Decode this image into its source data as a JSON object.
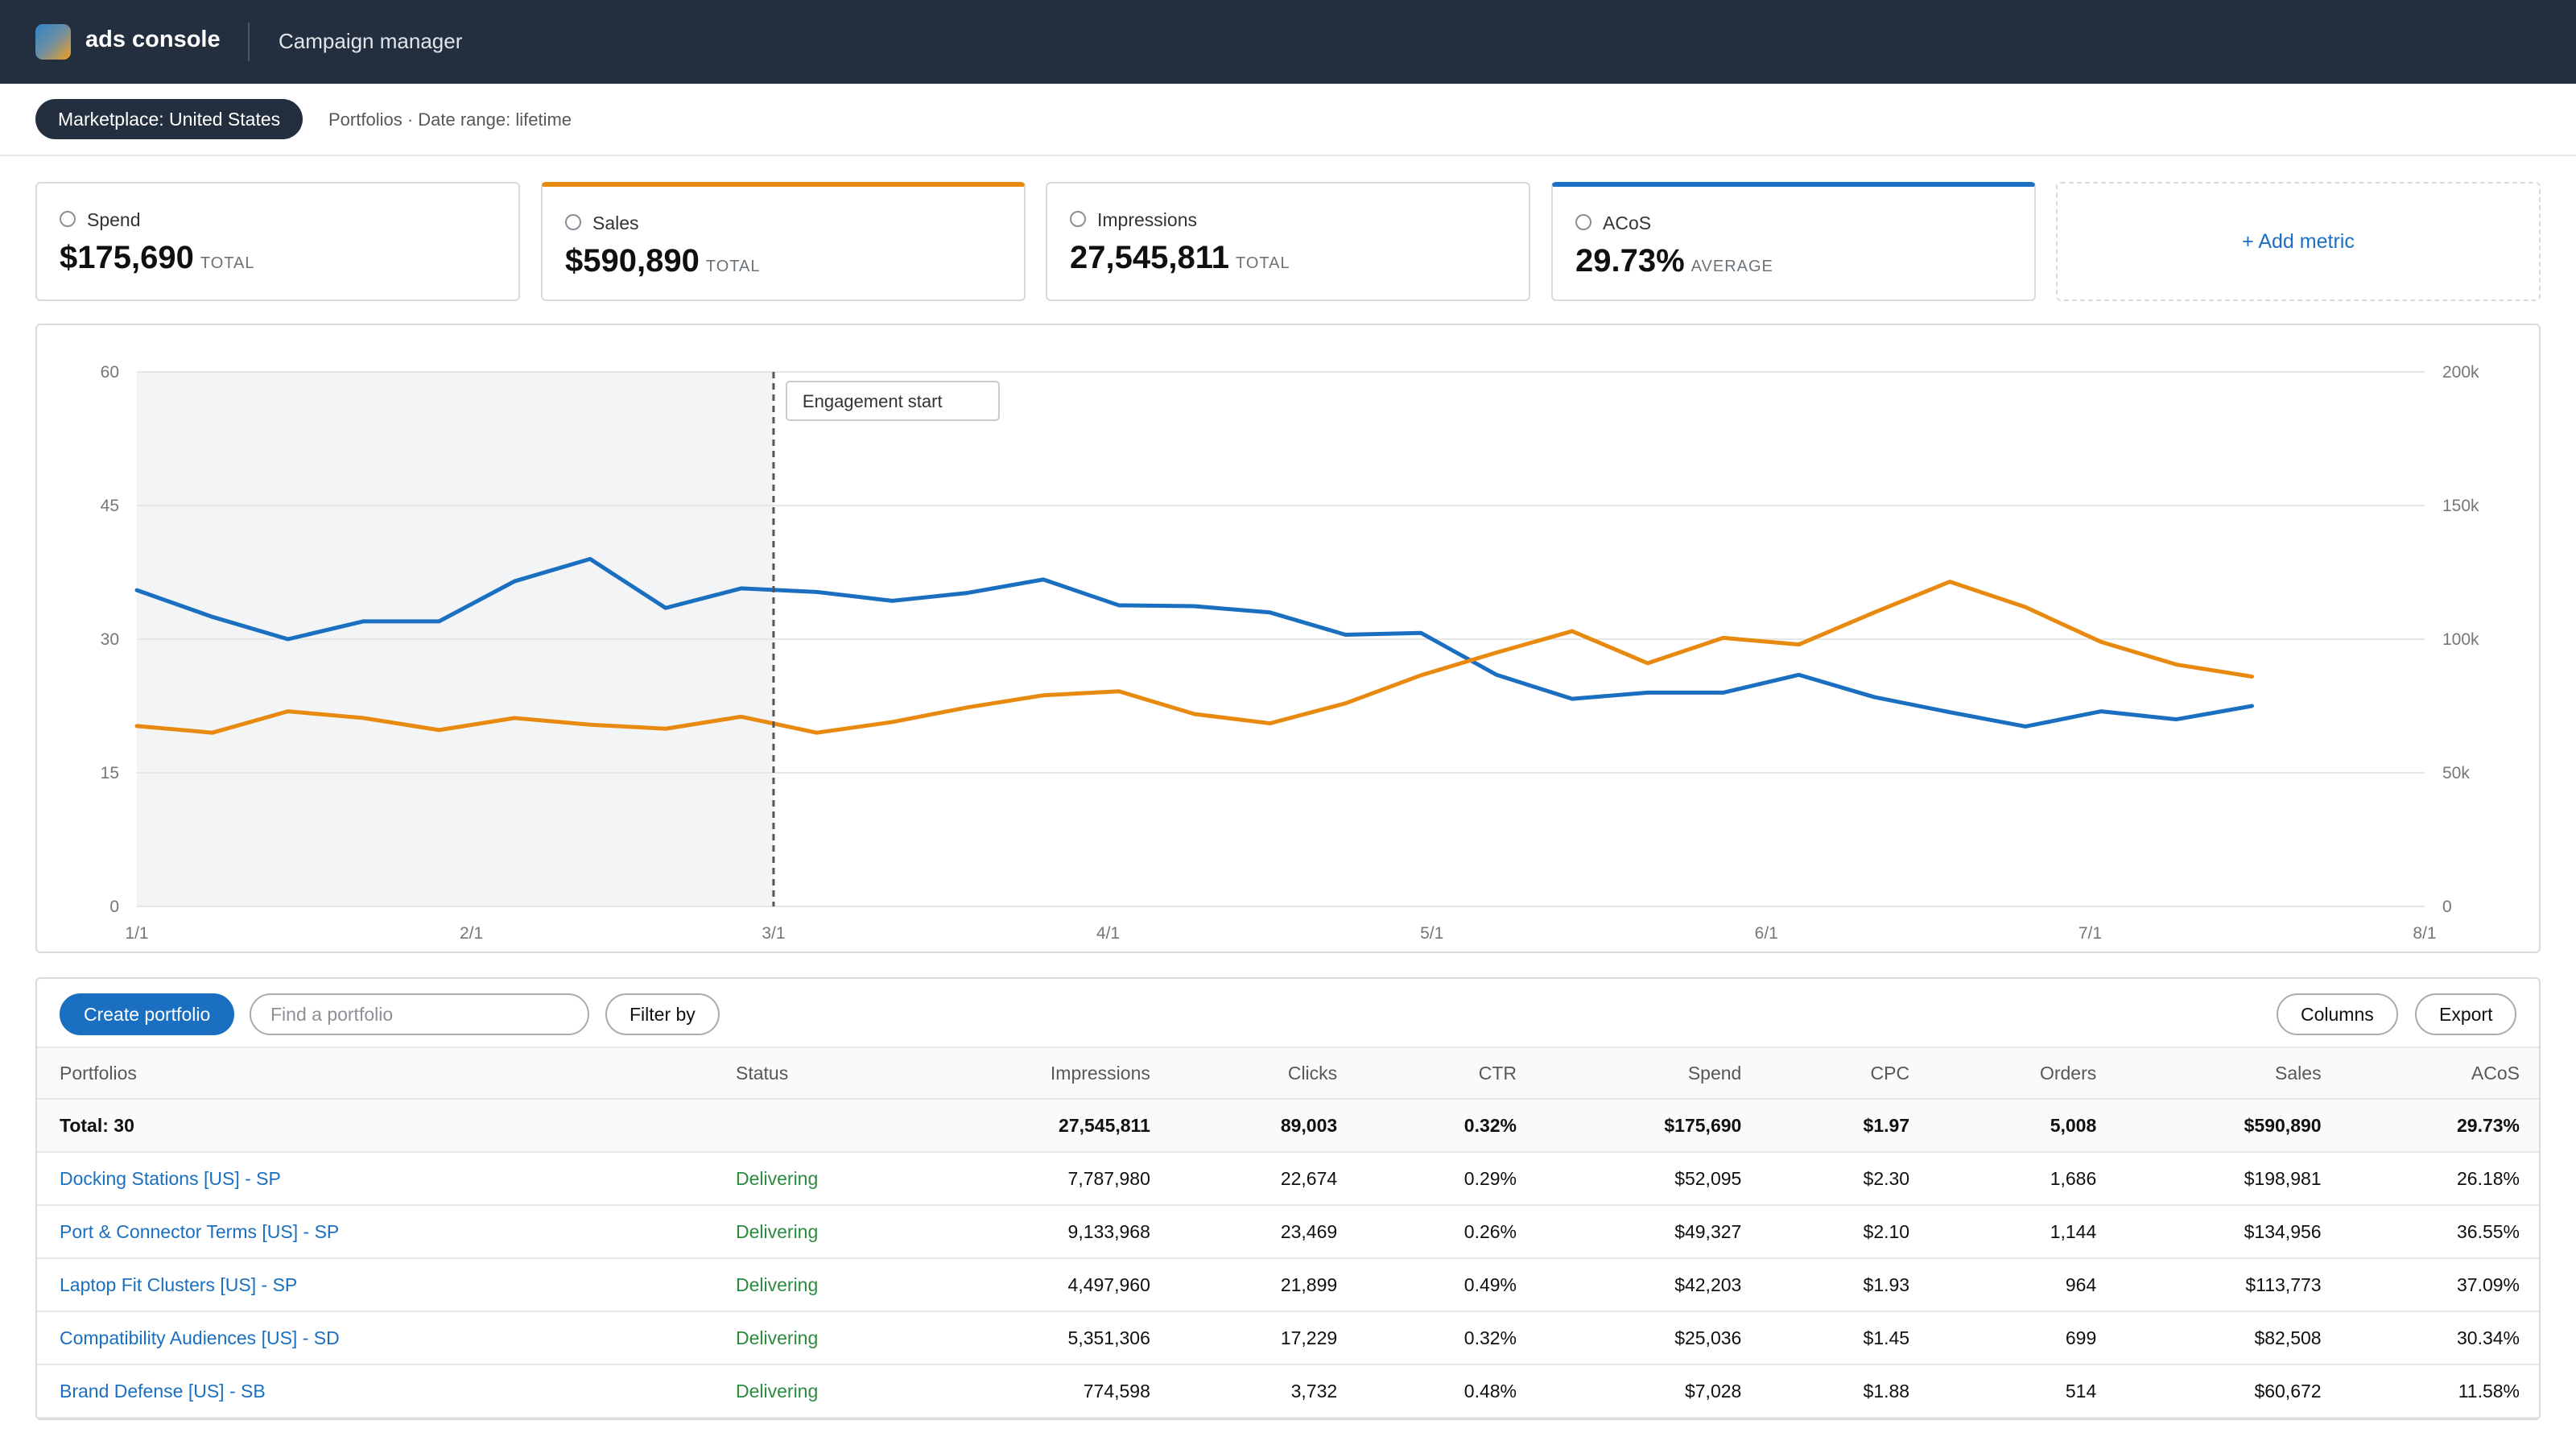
{
  "header": {
    "brand": "ads console",
    "section": "Campaign manager"
  },
  "subbar": {
    "marketplace": "Marketplace: United States",
    "context": "Portfolios · Date range: lifetime"
  },
  "metrics": [
    {
      "label": "Spend",
      "value": "$175,690",
      "unit": "TOTAL",
      "selected": false
    },
    {
      "label": "Sales",
      "value": "$590,890",
      "unit": "TOTAL",
      "selected": true,
      "color": "#e88a10"
    },
    {
      "label": "Impressions",
      "value": "27,545,811",
      "unit": "TOTAL",
      "selected": false
    },
    {
      "label": "ACoS",
      "value": "29.73%",
      "unit": "AVERAGE",
      "selected": true,
      "color": "#1a6fc0"
    }
  ],
  "add_metric": "+ Add metric",
  "chart_data": {
    "type": "line",
    "x": [
      "1/1",
      "1/8",
      "1/15",
      "1/22",
      "1/29",
      "2/5",
      "2/12",
      "2/19",
      "2/26",
      "3/5",
      "3/12",
      "3/19",
      "3/26",
      "4/2",
      "4/9",
      "4/16",
      "4/23",
      "4/30",
      "5/7",
      "5/14",
      "5/21",
      "5/28",
      "6/4",
      "6/11",
      "6/18",
      "6/25",
      "7/2",
      "7/9",
      "7/16",
      "7/23",
      "7/30"
    ],
    "x_ticks": [
      "1/1",
      "2/1",
      "3/1",
      "4/1",
      "5/1",
      "6/1",
      "7/1",
      "8/1"
    ],
    "y_left": {
      "ticks": [
        "0",
        "15",
        "30",
        "45",
        "60"
      ],
      "range": [
        0,
        60
      ]
    },
    "y_right": {
      "ticks": [
        "0",
        "50k",
        "100k",
        "150k",
        "200k"
      ],
      "range": [
        0,
        200000
      ]
    },
    "series": [
      {
        "name": "ACoS",
        "axis": "left",
        "color": "#1a6fc0",
        "values": [
          35.5,
          32.5,
          30,
          32,
          32,
          36.5,
          39,
          33.5,
          35.7,
          35.3,
          34.3,
          35.2,
          36.7,
          33.8,
          33.7,
          33,
          30.5,
          30.7,
          26,
          23.3,
          24,
          24,
          26,
          23.5,
          21.8,
          20.2,
          21.9,
          21,
          22.5
        ]
      },
      {
        "name": "Sales",
        "axis": "right",
        "color": "#e88a10",
        "values": [
          67500,
          65000,
          73000,
          70500,
          66000,
          70500,
          68000,
          66500,
          71000,
          65000,
          69000,
          74500,
          79000,
          80500,
          72000,
          68500,
          76000,
          86500,
          95000,
          103000,
          91000,
          100500,
          98000,
          110000,
          121500,
          112000,
          99000,
          90500,
          86000
        ]
      }
    ],
    "annotation": {
      "label": "Engagement start",
      "x": "3/1"
    },
    "shaded_range": [
      "1/1",
      "3/1"
    ]
  },
  "toolbar": {
    "create": "Create portfolio",
    "search_placeholder": "Find a portfolio",
    "filter": "Filter by",
    "columns": "Columns",
    "export": "Export"
  },
  "table": {
    "columns": [
      "Portfolios",
      "Status",
      "Impressions",
      "Clicks",
      "CTR",
      "Spend",
      "CPC",
      "Orders",
      "Sales",
      "ACoS"
    ],
    "total": [
      "Total: 30",
      "",
      "27,545,811",
      "89,003",
      "0.32%",
      "$175,690",
      "$1.97",
      "5,008",
      "$590,890",
      "29.73%"
    ],
    "rows": [
      [
        "Docking Stations [US] - SP",
        "Delivering",
        "7,787,980",
        "22,674",
        "0.29%",
        "$52,095",
        "$2.30",
        "1,686",
        "$198,981",
        "26.18%"
      ],
      [
        "Port & Connector Terms [US] - SP",
        "Delivering",
        "9,133,968",
        "23,469",
        "0.26%",
        "$49,327",
        "$2.10",
        "1,144",
        "$134,956",
        "36.55%"
      ],
      [
        "Laptop Fit Clusters [US] - SP",
        "Delivering",
        "4,497,960",
        "21,899",
        "0.49%",
        "$42,203",
        "$1.93",
        "964",
        "$113,773",
        "37.09%"
      ],
      [
        "Compatibility Audiences [US] - SD",
        "Delivering",
        "5,351,306",
        "17,229",
        "0.32%",
        "$25,036",
        "$1.45",
        "699",
        "$82,508",
        "30.34%"
      ],
      [
        "Brand Defense [US] - SB",
        "Delivering",
        "774,598",
        "3,732",
        "0.48%",
        "$7,028",
        "$1.88",
        "514",
        "$60,672",
        "11.58%"
      ]
    ]
  }
}
